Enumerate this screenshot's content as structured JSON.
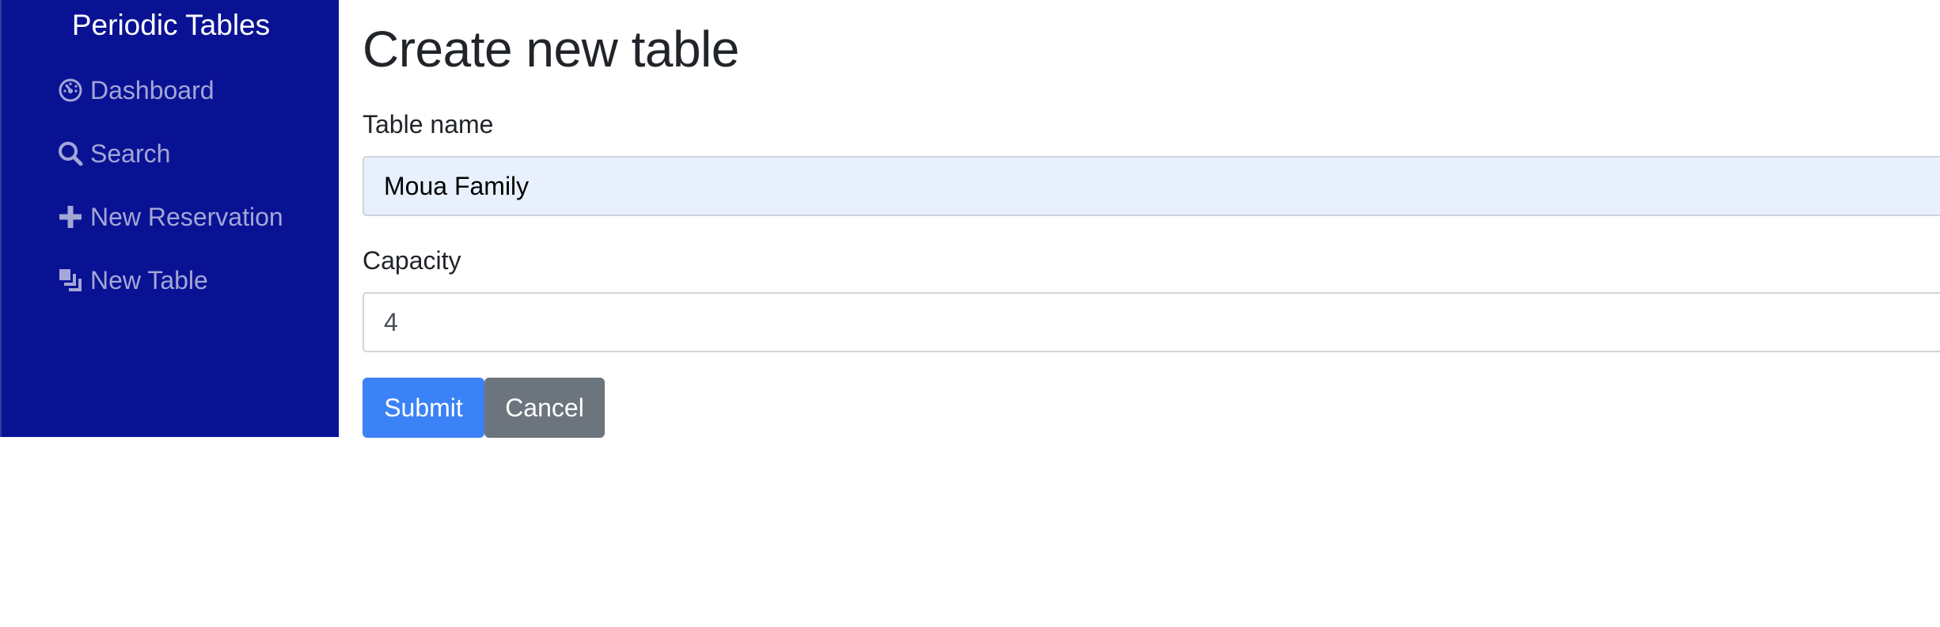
{
  "sidebar": {
    "brand": "Periodic Tables",
    "background": "#0a1294",
    "items": [
      {
        "label": "Dashboard",
        "icon": "dashboard-icon"
      },
      {
        "label": "Search",
        "icon": "search-icon"
      },
      {
        "label": "New Reservation",
        "icon": "plus-icon"
      },
      {
        "label": "New Table",
        "icon": "layers-icon"
      }
    ]
  },
  "main": {
    "title": "Create new table",
    "form": {
      "table_name": {
        "label": "Table name",
        "value": "Moua Family"
      },
      "capacity": {
        "label": "Capacity",
        "value": "4"
      },
      "submit_label": "Submit",
      "cancel_label": "Cancel"
    }
  },
  "colors": {
    "primary": "#3b82f6",
    "secondary": "#6c757d",
    "autofill": "#e8f0fe"
  }
}
